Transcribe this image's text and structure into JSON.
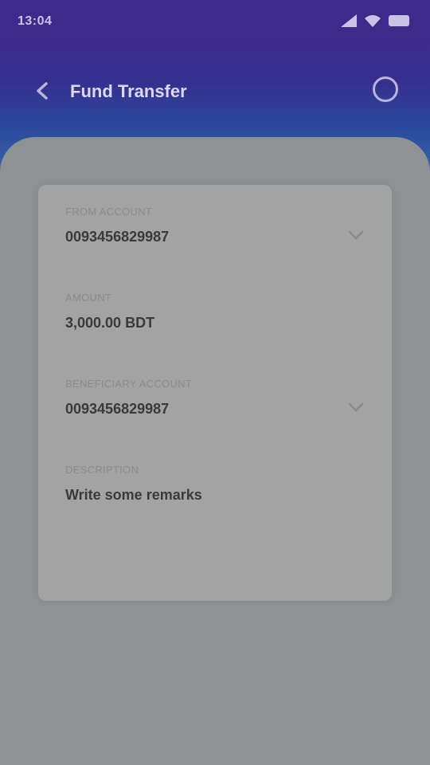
{
  "status_bar": {
    "time": "13:04"
  },
  "app_bar": {
    "title": "Fund Transfer"
  },
  "form": {
    "from_account": {
      "label": "FROM ACCOUNT",
      "value": "0093456829987"
    },
    "amount": {
      "label": "AMOUNT",
      "value": "3,000.00 BDT"
    },
    "to_account": {
      "label": "BENEFICIARY ACCOUNT",
      "value": "0093456829987"
    },
    "remarks": {
      "label": "DESCRIPTION",
      "value": "Write some remarks"
    }
  },
  "colors": {
    "header_top": "#3d2a8a",
    "header_bottom": "#3a6aa8",
    "overlay_background": "#8e9294",
    "card": "#a3a3a3"
  }
}
